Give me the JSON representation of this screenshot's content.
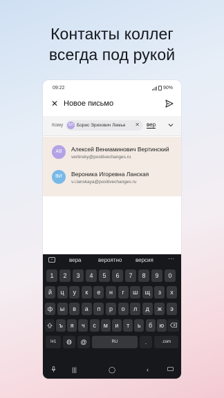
{
  "headline": [
    "Контакты коллег",
    "всегда под рукой"
  ],
  "status": {
    "time": "09:22",
    "battery": "90%"
  },
  "compose": {
    "title": "Новое письмо",
    "to_label": "Кому",
    "chip_initials": "БЛ",
    "chip_name": "Борис Эрихович Лемье",
    "typed_text": "вер"
  },
  "suggestions": [
    {
      "initials": "АВ",
      "name": "Алексей Вениаминович Вертинский",
      "email": "vertinsky@positivechanges.ru",
      "color": "#b3a3e6"
    },
    {
      "initials": "ВИ",
      "name": "Вероника Игоревна Ланская",
      "email": "v.i.lanskaya@positivechanges.ru",
      "color": "#78b9e8"
    }
  ],
  "keyboard": {
    "predictions": [
      "вера",
      "вероятно",
      "версия"
    ],
    "rows": [
      [
        "1",
        "2",
        "3",
        "4",
        "5",
        "6",
        "7",
        "8",
        "9",
        "0"
      ],
      [
        "й",
        "ц",
        "у",
        "к",
        "е",
        "н",
        "г",
        "ш",
        "щ",
        "з",
        "х"
      ],
      [
        "ф",
        "ы",
        "в",
        "а",
        "п",
        "р",
        "о",
        "л",
        "д",
        "ж",
        "э"
      ],
      [
        "ъ",
        "я",
        "ч",
        "с",
        "м",
        "и",
        "т",
        "ь",
        "б",
        "ю"
      ]
    ],
    "sym_label": "!#1",
    "comma": ",",
    "at": "@",
    "lang": "RU",
    "dot": ".",
    "com": ".com"
  }
}
